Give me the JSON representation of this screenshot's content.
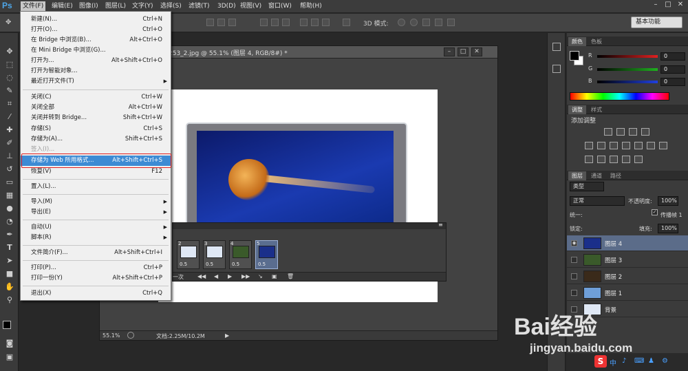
{
  "app": {
    "logo": "Ps"
  },
  "menubar": {
    "items": [
      "文件(F)",
      "编辑(E)",
      "图像(I)",
      "图层(L)",
      "文字(Y)",
      "选择(S)",
      "滤镜(T)",
      "3D(D)",
      "视图(V)",
      "窗口(W)",
      "帮助(H)"
    ],
    "active": "文件(F)"
  },
  "window_controls": {
    "minimize": "–",
    "maximize": "□",
    "close": "✕"
  },
  "options_bar": {
    "mode_label": "3D 模式:",
    "workspace": "基本功能"
  },
  "document": {
    "title": "253_2.jpg @ 55.1% (图层 4, RGB/8#) *",
    "zoom": "55.1%",
    "doc_size": "文档:2.25M/10.2M"
  },
  "animation": {
    "frames": [
      {
        "num": "2",
        "delay": "0.5"
      },
      {
        "num": "3",
        "delay": "0.5"
      },
      {
        "num": "4",
        "delay": "0.5"
      },
      {
        "num": "5",
        "delay": "0.5"
      }
    ],
    "loop": "一次"
  },
  "file_menu": {
    "items": [
      {
        "label": "新建(N)...",
        "shortcut": "Ctrl+N"
      },
      {
        "label": "打开(O)...",
        "shortcut": "Ctrl+O"
      },
      {
        "label": "在 Bridge 中浏览(B)...",
        "shortcut": "Alt+Ctrl+O"
      },
      {
        "label": "在 Mini Bridge 中浏览(G)...",
        "shortcut": ""
      },
      {
        "label": "打开为...",
        "shortcut": "Alt+Shift+Ctrl+O"
      },
      {
        "label": "打开为智能对象...",
        "shortcut": ""
      },
      {
        "label": "最近打开文件(T)",
        "shortcut": "",
        "submenu": true
      },
      {
        "label": "关闭(C)",
        "shortcut": "Ctrl+W"
      },
      {
        "label": "关闭全部",
        "shortcut": "Alt+Ctrl+W"
      },
      {
        "label": "关闭并转到 Bridge...",
        "shortcut": "Shift+Ctrl+W"
      },
      {
        "label": "存储(S)",
        "shortcut": "Ctrl+S"
      },
      {
        "label": "存储为(A)...",
        "shortcut": "Shift+Ctrl+S"
      },
      {
        "label": "签入(I)...",
        "shortcut": "",
        "disabled": true
      },
      {
        "label": "存储为 Web 所用格式...",
        "shortcut": "Alt+Shift+Ctrl+S",
        "highlighted": true
      },
      {
        "label": "恢复(V)",
        "shortcut": "F12"
      },
      {
        "label": "置入(L)...",
        "shortcut": ""
      },
      {
        "label": "导入(M)",
        "shortcut": "",
        "submenu": true
      },
      {
        "label": "导出(E)",
        "shortcut": "",
        "submenu": true
      },
      {
        "label": "自动(U)",
        "shortcut": "",
        "submenu": true
      },
      {
        "label": "脚本(R)",
        "shortcut": "",
        "submenu": true
      },
      {
        "label": "文件简介(F)...",
        "shortcut": "Alt+Shift+Ctrl+I"
      },
      {
        "label": "打印(P)...",
        "shortcut": "Ctrl+P"
      },
      {
        "label": "打印一份(Y)",
        "shortcut": "Alt+Shift+Ctrl+P"
      },
      {
        "label": "退出(X)",
        "shortcut": "Ctrl+Q"
      }
    ]
  },
  "color_panel": {
    "tabs": [
      "颜色",
      "色板"
    ],
    "channels": [
      {
        "name": "R",
        "value": "0",
        "color": "#e02020"
      },
      {
        "name": "G",
        "value": "0",
        "color": "#20b020"
      },
      {
        "name": "B",
        "value": "0",
        "color": "#2040e0"
      }
    ]
  },
  "adjust_panel": {
    "tabs": [
      "调整",
      "样式"
    ],
    "title": "添加调整"
  },
  "layers_panel": {
    "tabs": [
      "图层",
      "通道",
      "路径"
    ],
    "filter": "类型",
    "blend_mode": "正常",
    "opacity_label": "不透明度:",
    "opacity": "100%",
    "unify_label": "统一:",
    "propagate_label": "传播帧 1",
    "lock_label": "锁定:",
    "fill_label": "填充:",
    "fill": "100%",
    "layers": [
      {
        "name": "图层 4",
        "visible": true,
        "selected": true
      },
      {
        "name": "图层 3",
        "visible": false
      },
      {
        "name": "图层 2",
        "visible": false
      },
      {
        "name": "图层 1",
        "visible": false
      },
      {
        "name": "背景",
        "visible": false
      }
    ]
  },
  "watermark": {
    "brand": "Bai经验",
    "site": "jingyan.baidu.com"
  },
  "taskbar": {
    "ime": "中"
  }
}
